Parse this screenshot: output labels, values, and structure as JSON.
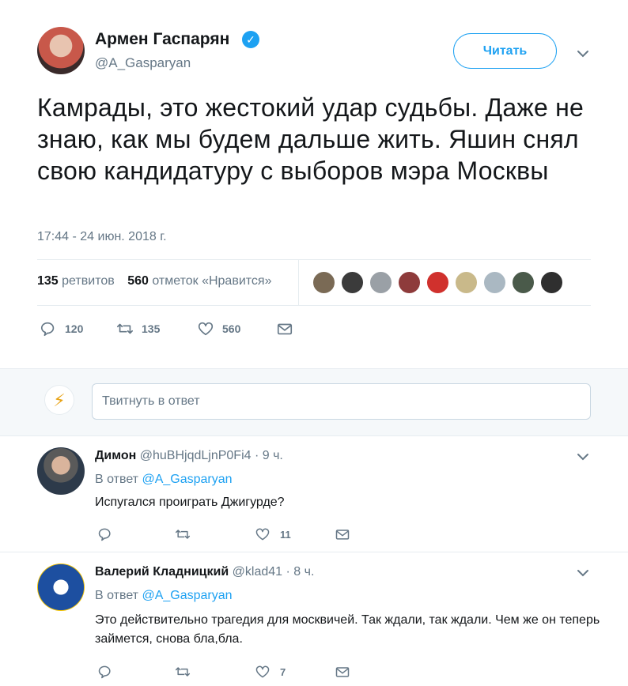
{
  "tweet": {
    "author_name": "Армен Гаспарян",
    "author_handle": "@A_Gasparyan",
    "follow_label": "Читать",
    "text": "Камрады, это жестокий удар судьбы. Даже не знаю, как мы будем дальше жить. Яшин снял свою кандидатуру с выборов мэра Москвы",
    "timestamp": "17:44 - 24 июн. 2018 г.",
    "retweets_count": "135",
    "retweets_label": "ретвитов",
    "likes_count": "560",
    "likes_label": "отметок «Нравится»",
    "actions": {
      "replies": "120",
      "retweets": "135",
      "likes": "560"
    },
    "liker_avatar_colors": [
      "#7a6a55",
      "#3b3b3b",
      "#9aa0a6",
      "#8e3b3b",
      "#d0312d",
      "#c9b98a",
      "#aab8c2",
      "#4a5a4a",
      "#2f2f2f"
    ]
  },
  "reply_box": {
    "placeholder": "Твитнуть в ответ"
  },
  "replies": [
    {
      "name": "Димон",
      "handle": "@huBHjqdLjnP0Fi4",
      "sep": "·",
      "time": "9 ч.",
      "in_reply_prefix": "В ответ",
      "in_reply_to": "@A_Gasparyan",
      "text": "Испугался проиграть Джигурде?",
      "replies": "",
      "retweets": "",
      "likes": "11"
    },
    {
      "name": "Валерий Кладницкий",
      "handle": "@klad41",
      "sep": "·",
      "time": "8 ч.",
      "in_reply_prefix": "В ответ",
      "in_reply_to": "@A_Gasparyan",
      "text": "Это действительно трагедия для москвичей. Так ждали, так ждали. Чем же он теперь займется, снова бла,бла.",
      "replies": "",
      "retweets": "",
      "likes": "7"
    }
  ],
  "colors": {
    "accent": "#1da1f2",
    "muted": "#657786",
    "divider": "#e6ecf0",
    "text": "#14171a"
  }
}
